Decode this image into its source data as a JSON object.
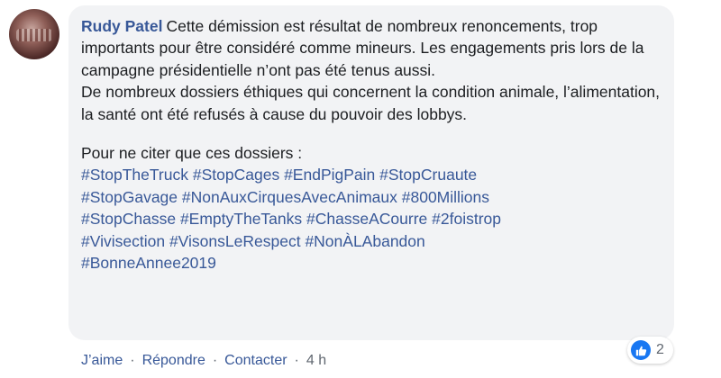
{
  "comment": {
    "author": "Rudy Patel",
    "paragraph1": "Cette démission est résultat de nombreux renoncements, trop importants pour être considéré comme mineurs. Les engagements pris lors de la campagne présidentielle n’ont pas été tenus aussi.",
    "paragraph2": "De nombreux dossiers éthiques qui concernent la condition animale, l’alimentation, la santé ont été refusés à cause du pouvoir des lobbys.",
    "intro": "Pour ne citer que ces dossiers :",
    "hashtags": [
      "#StopTheTruck",
      "#StopCages",
      "#EndPigPain",
      "#StopCruaute",
      "#StopGavage",
      "#NonAuxCirquesAvecAnimaux",
      "#800Millions",
      "#StopChasse",
      "#EmptyTheTanks",
      "#ChasseACourre",
      "#2foistrop",
      "#Vivisection",
      "#VisonsLeRespect",
      "#NonÀLAbandon",
      "#BonneAnnee2019"
    ]
  },
  "reactions": {
    "icon": "like-icon",
    "count": "2",
    "color": "#1877f2"
  },
  "actions": {
    "like": "J’aime",
    "reply": "Répondre",
    "contact": "Contacter",
    "time": "4 h",
    "separator": "·"
  },
  "colors": {
    "link": "#385898",
    "bubble": "#f2f3f5",
    "meta": "#606770"
  }
}
